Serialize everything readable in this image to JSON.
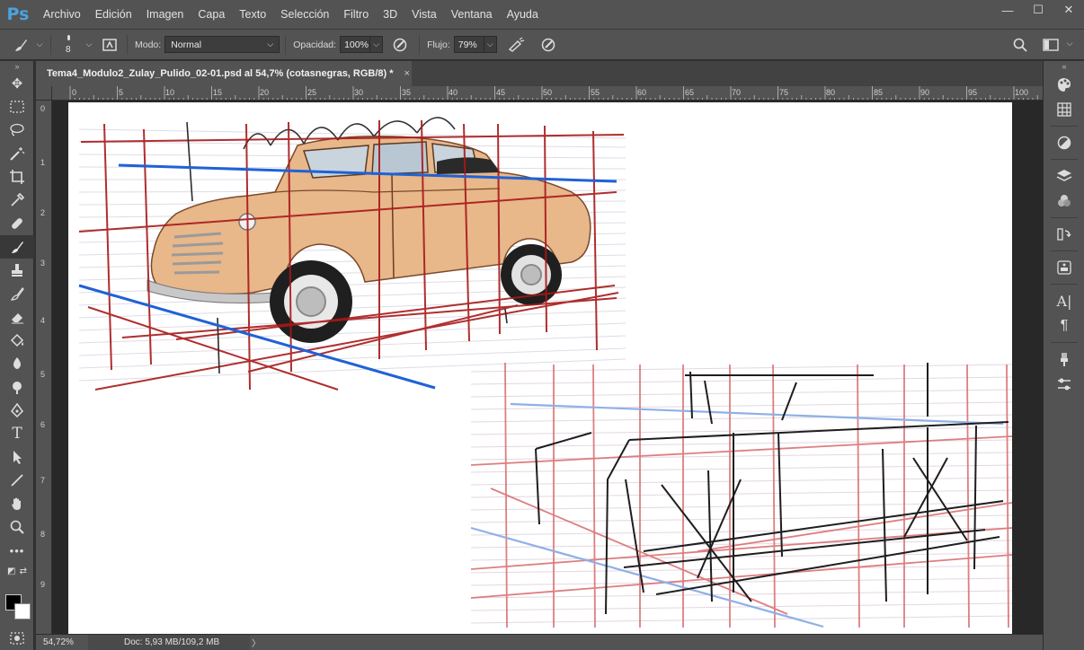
{
  "app": {
    "logo": "Ps"
  },
  "menu": [
    "Archivo",
    "Edición",
    "Imagen",
    "Capa",
    "Texto",
    "Selección",
    "Filtro",
    "3D",
    "Vista",
    "Ventana",
    "Ayuda"
  ],
  "window_controls": [
    "—",
    "☐",
    "✕"
  ],
  "options": {
    "brush_size": "8",
    "mode_label": "Modo:",
    "mode_value": "Normal",
    "opacity_label": "Opacidad:",
    "opacity_value": "100%",
    "flow_label": "Flujo:",
    "flow_value": "79%"
  },
  "document": {
    "tab_title": "Tema4_Modulo2_Zulay_Pulido_02-01.psd al 54,7% (cotasnegras, RGB/8) *",
    "close": "×"
  },
  "ruler": {
    "top": [
      "0",
      "5",
      "10",
      "15",
      "20",
      "25",
      "30",
      "35",
      "40",
      "45",
      "50",
      "55",
      "60",
      "65",
      "70",
      "75",
      "80",
      "85",
      "90",
      "95",
      "100"
    ],
    "left": [
      "0",
      "1",
      "2",
      "3",
      "4",
      "5",
      "6",
      "7",
      "8",
      "9"
    ]
  },
  "status": {
    "zoom": "54,72%",
    "doc_info": "Doc: 5,93 MB/109,2 MB",
    "arrow": "〉"
  },
  "colors": {
    "foreground": "#000000",
    "background": "#ffffff",
    "accent": "#4aa3df"
  }
}
